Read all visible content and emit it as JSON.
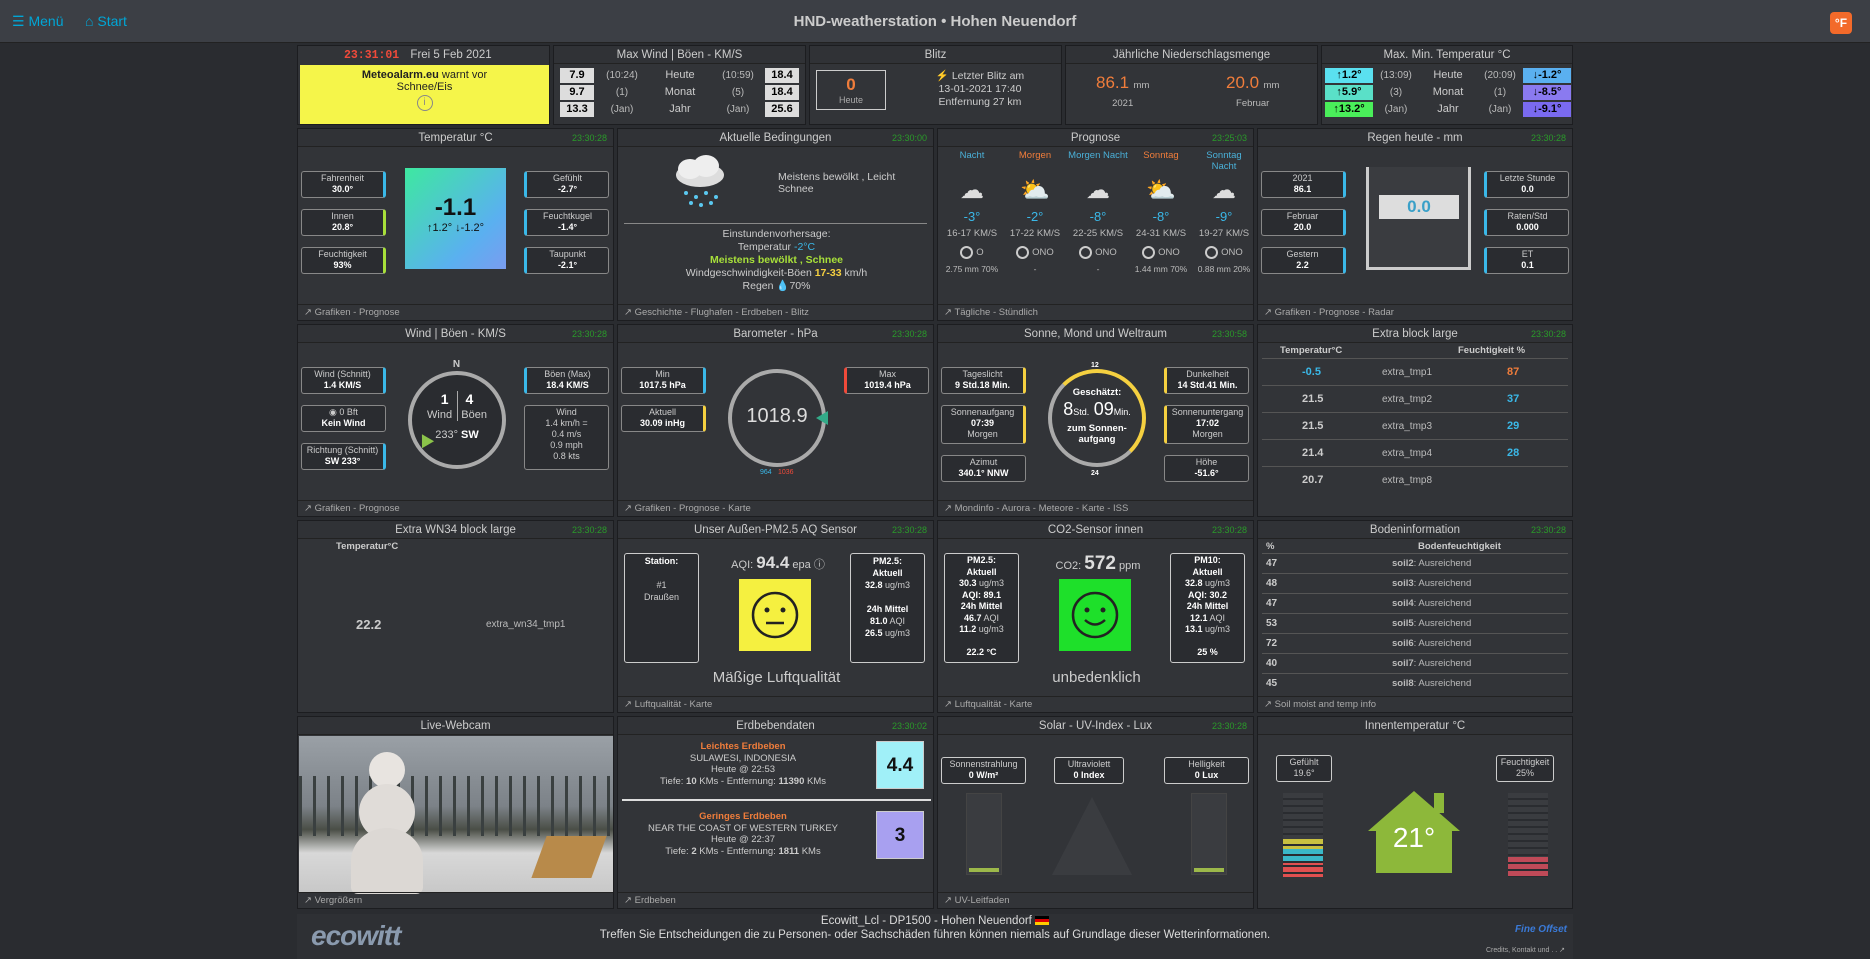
{
  "topbar": {
    "menu": "Menü",
    "start": "Start",
    "title": "HND-weatherstation  •  Hohen Neuendorf",
    "unit": "°F"
  },
  "alert": {
    "time": "23:31:01",
    "date": "Frei 5 Feb 2021",
    "text1": "Meteoalarm.eu",
    "text2": " warnt vor",
    "text3": "Schnee/Eis"
  },
  "maxwind": {
    "title": "Max Wind | Böen - KM/S",
    "rows": [
      [
        "7.9",
        "(10:24)",
        "Heute",
        "(10:59)",
        "18.4"
      ],
      [
        "9.7",
        "(1)",
        "Monat",
        "(5)",
        "18.4"
      ],
      [
        "13.3",
        "(Jan)",
        "Jahr",
        "(Jan)",
        "25.6"
      ]
    ]
  },
  "blitz": {
    "title": "Blitz",
    "count": "0",
    "count_label": "Heute",
    "last1": "Letzter Blitz am",
    "last2": "13-01-2021 17:40",
    "last3": "Entfernung 27 km"
  },
  "rain_year": {
    "title": "Jährliche Niederschlagsmenge",
    "v1": "86.1",
    "u1": "mm",
    "l1": "2021",
    "v2": "20.0",
    "u2": "mm",
    "l2": "Februar"
  },
  "maxmin": {
    "title": "Max. Min. Temperatur °C",
    "rows": [
      [
        "↑1.2°",
        "(13:09)",
        "Heute",
        "(20:09)",
        "↓-1.2°"
      ],
      [
        "↑5.9°",
        "(3)",
        "Monat",
        "(1)",
        "↓-8.5°"
      ],
      [
        "↑13.2°",
        "(Jan)",
        "Jahr",
        "(Jan)",
        "↓-9.1°"
      ]
    ]
  },
  "temp": {
    "title": "Temperatur °C",
    "time": "23:30:28",
    "fahr_l": "Fahrenheit",
    "fahr": "30.0°",
    "innen_l": "Innen",
    "innen": "20.8°",
    "feucht_l": "Feuchtigkeit",
    "feucht": "93%",
    "value": "-1.1",
    "hilo": "↑1.2° ↓-1.2°",
    "gef_l": "Gefühlt",
    "gef": "-2.7°",
    "fk_l": "Feuchtkugel",
    "fk": "-1.4°",
    "tp_l": "Taupunkt",
    "tp": "-2.1°",
    "footer": "Grafiken - Prognose"
  },
  "cond": {
    "title": "Aktuelle Bedingungen",
    "time": "23:30:00",
    "text": "Meistens bewölkt , Leicht Schnee",
    "f1": "Einstundenvorhersage:",
    "f2": "Temperatur ",
    "f2v": "-2°C",
    "f3": "Meistens bewölkt , Schnee",
    "f4": "Windgeschwindigkeit-Böen ",
    "f4v": "17-33",
    "f4u": " km/h",
    "f5": "Regen ",
    "f5v": "70%",
    "footer": "Geschichte - Flughafen - Erdbeben - Blitz"
  },
  "prog": {
    "title": "Prognose",
    "time": "23:25:03",
    "days": [
      {
        "n": "Nacht",
        "c": "#4ab0d8",
        "t": "-3°",
        "w": "16-17 KM/S",
        "d": "O",
        "r": "2.75 mm 70%"
      },
      {
        "n": "Morgen",
        "c": "#f07d3b",
        "t": "-2°",
        "w": "17-22 KM/S",
        "d": "ONO",
        "r": "-"
      },
      {
        "n": "Morgen Nacht",
        "c": "#4ab0d8",
        "t": "-8°",
        "w": "22-25 KM/S",
        "d": "ONO",
        "r": "-"
      },
      {
        "n": "Sonntag",
        "c": "#f07d3b",
        "t": "-8°",
        "w": "24-31 KM/S",
        "d": "ONO",
        "r": "1.44 mm 70%"
      },
      {
        "n": "Sonntag Nacht",
        "c": "#4ab0d8",
        "t": "-9°",
        "w": "19-27 KM/S",
        "d": "ONO",
        "r": "0.88 mm 20%"
      }
    ],
    "footer": "Tägliche - Stündlich"
  },
  "rain": {
    "title": "Regen heute - mm",
    "time": "23:30:28",
    "y_l": "2021",
    "y": "86.1",
    "m_l": "Februar",
    "m": "20.0",
    "g_l": "Gestern",
    "g": "2.2",
    "value": "0.0",
    "ls_l": "Letzte Stunde",
    "ls": "0.0",
    "rs_l": "Raten/Std",
    "rs": "0.000",
    "et_l": "ET",
    "et": "0.1",
    "footer": "Grafiken - Prognose - Radar"
  },
  "wind": {
    "title": "Wind | Böen - KM/S",
    "time": "23:30:28",
    "avg_l": "Wind (Schnitt)",
    "avg": "1.4 KM/S",
    "bft_l": "0 Bft",
    "bft": "Kein Wind",
    "dir_l": "Richtung (Schnitt)",
    "dir": "SW 233°",
    "n": "N",
    "w1": "1",
    "w2": "4",
    "wl1": "Wind",
    "wl2": "Böen",
    "deg": "233°",
    "card": "SW",
    "gust_l": "Böen (Max)",
    "gust": "18.4 KM/S",
    "conv_l": "Wind",
    "c1": "1.4 km/h =",
    "c2": "0.4 m/s",
    "c3": "0.9 mph",
    "c4": "0.8 kts",
    "footer": "Grafiken - Prognose"
  },
  "baro": {
    "title": "Barometer - hPa",
    "time": "23:30:28",
    "min_l": "Min",
    "min": "1017.5 hPa",
    "akt_l": "Aktuell",
    "akt": "30.09 inHg",
    "value": "1018.9",
    "max_l": "Max",
    "max": "1019.4 hPa",
    "lo": "964",
    "hi": "1036",
    "footer": "Grafiken - Prognose - Karte"
  },
  "sun": {
    "title": "Sonne, Mond und Weltraum",
    "time": "23:30:58",
    "tl_l": "Tageslicht",
    "tl": "9 Std.18 Min.",
    "sa_l": "Sonnenaufgang",
    "sa": "07:39",
    "sa2": "Morgen",
    "az_l": "Azimut",
    "az": "340.1° NNW",
    "est": "Geschätzt:",
    "h": "8",
    "hl": "Std.",
    "m": "09",
    "ml": "Min.",
    "to": "zum Sonnen-",
    "to2": "aufgang",
    "t12": "12",
    "t24": "24",
    "dk_l": "Dunkelheit",
    "dk": "14 Std.41 Min.",
    "su_l": "Sonnenuntergang",
    "su": "17:02",
    "su2": "Morgen",
    "ho_l": "Höhe",
    "ho": "-51.6°",
    "footer": "Mondinfo - Aurora - Meteore - Karte - ISS"
  },
  "extra": {
    "title": "Extra block large",
    "time": "23:30:28",
    "h1": "Temperatur°C",
    "h2": "Feuchtigkeit %",
    "rows": [
      [
        "-0.5",
        "extra_tmp1",
        "87"
      ],
      [
        "21.5",
        "extra_tmp2",
        "37"
      ],
      [
        "21.5",
        "extra_tmp3",
        "29"
      ],
      [
        "21.4",
        "extra_tmp4",
        "28"
      ],
      [
        "20.7",
        "extra_tmp8",
        ""
      ]
    ]
  },
  "wn34": {
    "title": "Extra WN34 block large",
    "time": "23:30:28",
    "h": "Temperatur°C",
    "v": "22.2",
    "n": "extra_wn34_tmp1"
  },
  "pm": {
    "title": "Unser Außen-PM2.5 AQ Sensor",
    "time": "23:30:28",
    "st1": "Station:",
    "st2": "#1",
    "st3": "Draußen",
    "aqi_l": "AQI: ",
    "aqi": "94.4",
    "epa": " epa",
    "r1": "PM2.5:",
    "r2": "Aktuell",
    "r3": "32.8",
    "r3u": " ug/m3",
    "r4": "24h Mittel",
    "r5": "81.0",
    "r5u": " AQI",
    "r6": "26.5",
    "r6u": " ug/m3",
    "status": "Mäßige Luftqualität",
    "footer": "Luftqualität - Karte"
  },
  "co2": {
    "title": "CO2-Sensor innen",
    "time": "23:30:28",
    "l1": "PM2.5:",
    "l2": "Aktuell",
    "l3": "30.3",
    "l3u": " ug/m3",
    "l4": "AQI: ",
    "l4v": "89.1",
    "l5": "24h Mittel",
    "l6": "46.7",
    "l6u": " AQI",
    "l7": "11.2",
    "l7u": " ug/m3",
    "l8": "22.2 °C",
    "co2_l": "CO2: ",
    "co2": "572",
    "ppm": " ppm",
    "r1": "PM10:",
    "r2": "Aktuell",
    "r3": "32.8",
    "r3u": " ug/m3",
    "r4": "AQI: ",
    "r4v": "30.2",
    "r5": "24h Mittel",
    "r6": "12.1",
    "r6u": " AQI",
    "r7": "13.1",
    "r7u": " ug/m3",
    "r8": "25 %",
    "status": "unbedenklich",
    "footer": "Luftqualität - Karte"
  },
  "soil": {
    "title": "Bodeninformation",
    "time": "23:30:28",
    "h1": "%",
    "h2": "Bodenfeuchtigkeit",
    "rows": [
      [
        "47",
        "soil2",
        ": Ausreichend"
      ],
      [
        "48",
        "soil3",
        ": Ausreichend"
      ],
      [
        "47",
        "soil4",
        ": Ausreichend"
      ],
      [
        "53",
        "soil5",
        ": Ausreichend"
      ],
      [
        "72",
        "soil6",
        ": Ausreichend"
      ],
      [
        "40",
        "soil7",
        ": Ausreichend"
      ],
      [
        "45",
        "soil8",
        ": Ausreichend"
      ]
    ],
    "footer": "Soil moist and temp info"
  },
  "webcam": {
    "title": "Live-Webcam",
    "footer": "Vergrößern"
  },
  "quake": {
    "title": "Erdbebendaten",
    "time": "23:30:02",
    "q1": {
      "type": "Leichtes Erdbeben",
      "place": "SULAWESI, INDONESIA",
      "when": "Heute @ 22:53",
      "depth_l": "Tiefe: ",
      "depth": "10",
      "dist_l": " KMs - Entfernung: ",
      "dist": "11390",
      "unit": " KMs",
      "mag": "4.4"
    },
    "q2": {
      "type": "Geringes Erdbeben",
      "place": "NEAR THE COAST OF WESTERN TURKEY",
      "when": "Heute @ 22:37",
      "depth_l": "Tiefe: ",
      "depth": "2",
      "dist_l": " KMs - Entfernung: ",
      "dist": "1811",
      "unit": " KMs",
      "mag": "3"
    },
    "footer": "Erdbeben"
  },
  "solar": {
    "title": "Solar - UV-Index - Lux",
    "time": "23:30:28",
    "s_l": "Sonnenstrahlung",
    "s": "0 W/m²",
    "u_l": "Ultraviolett",
    "u": "0 Index",
    "h_l": "Helligkeit",
    "h": "0 Lux",
    "footer": "UV-Leitfaden"
  },
  "indoor": {
    "title": "Innentemperatur °C",
    "g_l": "Gefühlt",
    "g": "19.6°",
    "f_l": "Feuchtigkeit",
    "f": "25%",
    "v": "21°"
  },
  "footer": {
    "logo": "ecowitt",
    "l1": "Ecowitt_Lcl  -  DP1500  -  Hohen Neuendorf",
    "l2": "Treffen Sie Entscheidungen die zu Personen- oder Sachschäden führen können niemals auf Grundlage dieser Wetterinformationen.",
    "fo": "Fine Offset",
    "credits": "Credits, Kontakt und . ."
  }
}
